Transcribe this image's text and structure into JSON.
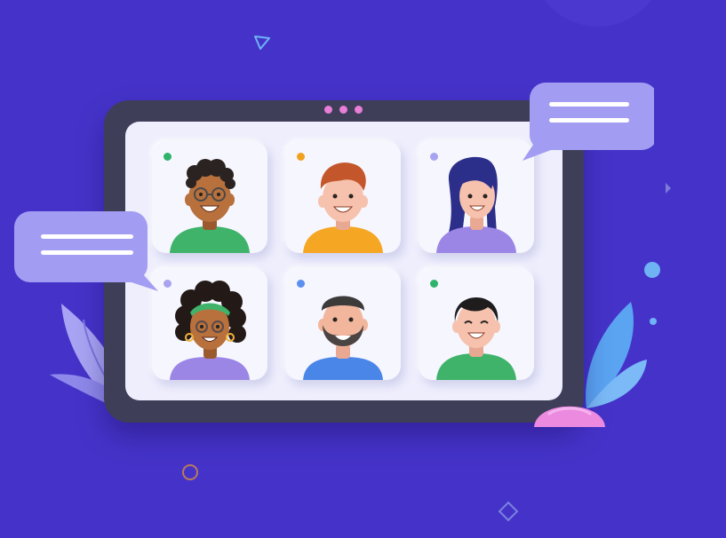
{
  "colors": {
    "background": "#4533c9",
    "tablet_frame": "#3f3e58",
    "screen": "#eeeefd",
    "bubble": "#9d98f0",
    "camera_dots": "#e87ed6"
  },
  "participants": [
    {
      "icon": "man-curly-hair-glasses-avatar-icon",
      "status_color": "#2fb36b",
      "shirt": "#3fb36a"
    },
    {
      "icon": "man-red-hair-avatar-icon",
      "status_color": "#f0a21e",
      "shirt": "#f5a623"
    },
    {
      "icon": "woman-long-hair-avatar-icon",
      "status_color": "#a7a3f0",
      "shirt": "#9b86e6"
    },
    {
      "icon": "woman-curly-hair-headband-avatar-icon",
      "status_color": "#a7a3f0",
      "shirt": "#9b86e6"
    },
    {
      "icon": "man-bearded-avatar-icon",
      "status_color": "#5b8ff0",
      "shirt": "#4a86e8"
    },
    {
      "icon": "man-black-hair-avatar-icon",
      "status_color": "#2fb36b",
      "shirt": "#3fb36a"
    }
  ],
  "chat_bubbles": [
    {
      "icon": "chat-bubble-icon",
      "side": "right"
    },
    {
      "icon": "chat-bubble-icon",
      "side": "left"
    }
  ]
}
